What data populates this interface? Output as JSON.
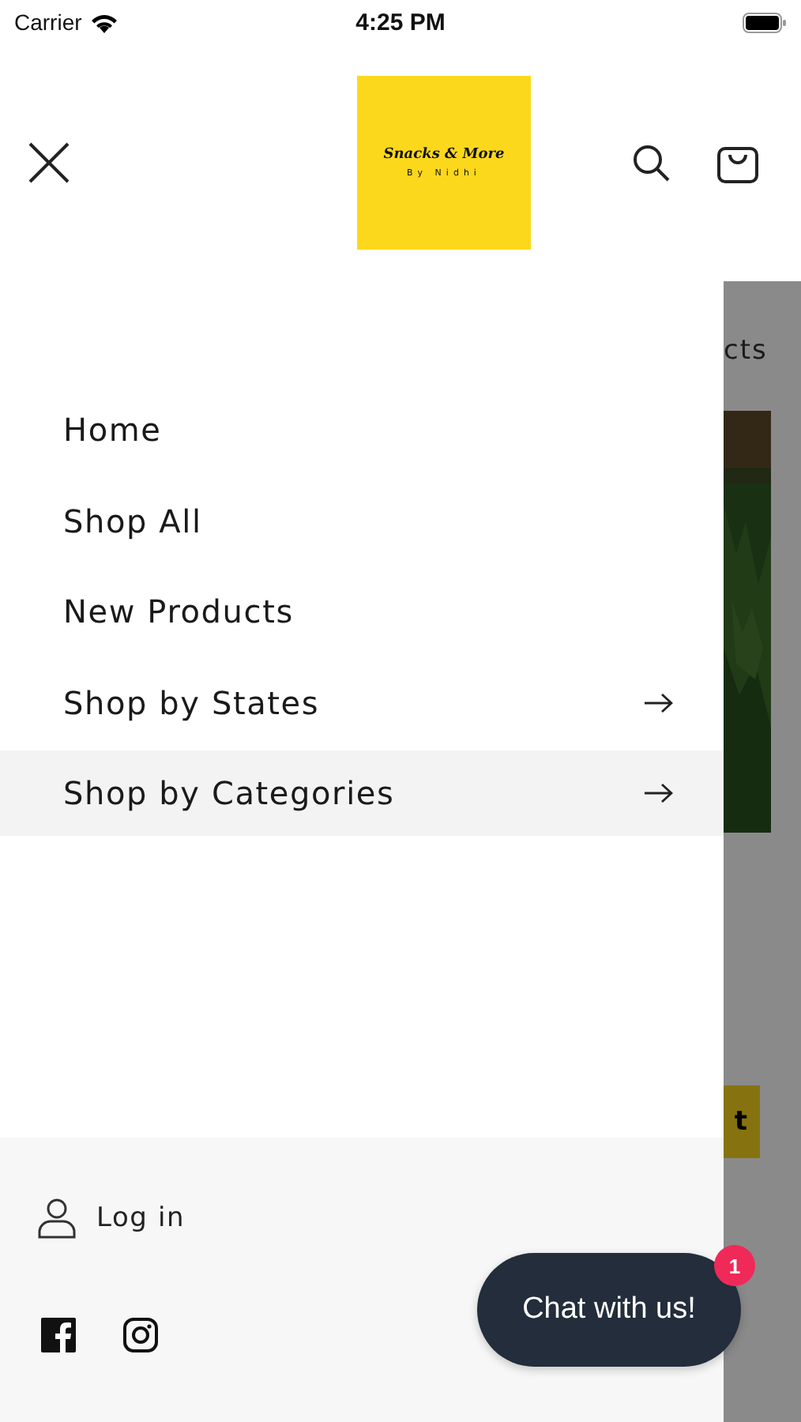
{
  "status_bar": {
    "carrier": "Carrier",
    "time": "4:25 PM"
  },
  "logo": {
    "title": "Snacks & More",
    "subtitle": "By Nidhi"
  },
  "menu": [
    {
      "label": "Home",
      "kind": "link",
      "selected": false
    },
    {
      "label": "Shop All",
      "kind": "link",
      "selected": false
    },
    {
      "label": "New Products",
      "kind": "link",
      "selected": false
    },
    {
      "label": "Shop by States",
      "kind": "submenu",
      "selected": false
    },
    {
      "label": "Shop by Categories",
      "kind": "submenu",
      "selected": true
    }
  ],
  "account": {
    "label": "Log in"
  },
  "chat": {
    "label": "Chat with us!",
    "badge": "1"
  },
  "background_page": {
    "heading": "cts",
    "button": "t"
  }
}
